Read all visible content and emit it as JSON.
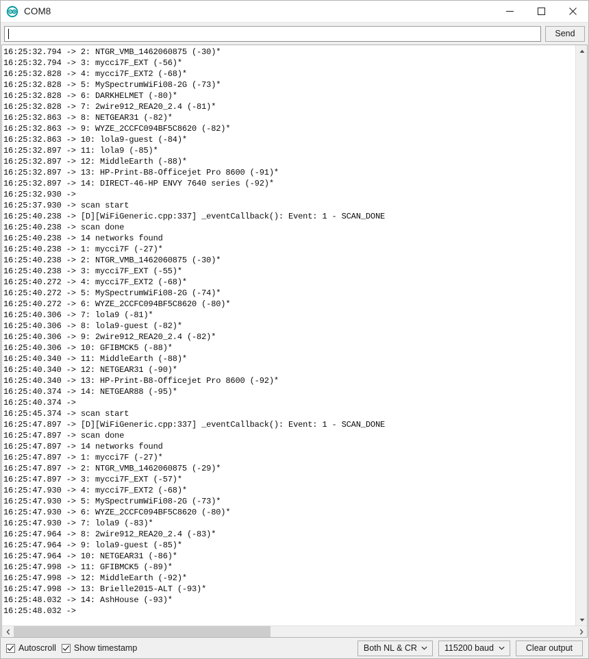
{
  "window": {
    "title": "COM8",
    "app_icon": "arduino-infinity-icon",
    "icon_color": "#00979c",
    "controls": {
      "minimize": "minimize-icon",
      "maximize": "maximize-icon",
      "close": "close-icon"
    }
  },
  "send_row": {
    "input_value": "",
    "input_placeholder": "",
    "send_label": "Send"
  },
  "console": {
    "lines": [
      "16:25:32.794 -> 2: NTGR_VMB_1462060875 (-30)*",
      "16:25:32.794 -> 3: mycci7F_EXT (-56)*",
      "16:25:32.828 -> 4: mycci7F_EXT2 (-68)*",
      "16:25:32.828 -> 5: MySpectrumWiFi08-2G (-73)*",
      "16:25:32.828 -> 6: DARKHELMET (-80)*",
      "16:25:32.828 -> 7: 2wire912_REA20_2.4 (-81)*",
      "16:25:32.863 -> 8: NETGEAR31 (-82)*",
      "16:25:32.863 -> 9: WYZE_2CCFC094BF5C8620 (-82)*",
      "16:25:32.863 -> 10: lola9-guest (-84)*",
      "16:25:32.897 -> 11: lola9 (-85)*",
      "16:25:32.897 -> 12: MiddleEarth (-88)*",
      "16:25:32.897 -> 13: HP-Print-B8-Officejet Pro 8600 (-91)*",
      "16:25:32.897 -> 14: DIRECT-46-HP ENVY 7640 series (-92)*",
      "16:25:32.930 -> ",
      "16:25:37.930 -> scan start",
      "16:25:40.238 -> [D][WiFiGeneric.cpp:337] _eventCallback(): Event: 1 - SCAN_DONE",
      "16:25:40.238 -> scan done",
      "16:25:40.238 -> 14 networks found",
      "16:25:40.238 -> 1: mycci7F (-27)*",
      "16:25:40.238 -> 2: NTGR_VMB_1462060875 (-30)*",
      "16:25:40.238 -> 3: mycci7F_EXT (-55)*",
      "16:25:40.272 -> 4: mycci7F_EXT2 (-68)*",
      "16:25:40.272 -> 5: MySpectrumWiFi08-2G (-74)*",
      "16:25:40.272 -> 6: WYZE_2CCFC094BF5C8620 (-80)*",
      "16:25:40.306 -> 7: lola9 (-81)*",
      "16:25:40.306 -> 8: lola9-guest (-82)*",
      "16:25:40.306 -> 9: 2wire912_REA20_2.4 (-82)*",
      "16:25:40.306 -> 10: GFIBMCK5 (-88)*",
      "16:25:40.340 -> 11: MiddleEarth (-88)*",
      "16:25:40.340 -> 12: NETGEAR31 (-90)*",
      "16:25:40.340 -> 13: HP-Print-B8-Officejet Pro 8600 (-92)*",
      "16:25:40.374 -> 14: NETGEAR88 (-95)*",
      "16:25:40.374 -> ",
      "16:25:45.374 -> scan start",
      "16:25:47.897 -> [D][WiFiGeneric.cpp:337] _eventCallback(): Event: 1 - SCAN_DONE",
      "16:25:47.897 -> scan done",
      "16:25:47.897 -> 14 networks found",
      "16:25:47.897 -> 1: mycci7F (-27)*",
      "16:25:47.897 -> 2: NTGR_VMB_1462060875 (-29)*",
      "16:25:47.897 -> 3: mycci7F_EXT (-57)*",
      "16:25:47.930 -> 4: mycci7F_EXT2 (-68)*",
      "16:25:47.930 -> 5: MySpectrumWiFi08-2G (-73)*",
      "16:25:47.930 -> 6: WYZE_2CCFC094BF5C8620 (-80)*",
      "16:25:47.930 -> 7: lola9 (-83)*",
      "16:25:47.964 -> 8: 2wire912_REA20_2.4 (-83)*",
      "16:25:47.964 -> 9: lola9-guest (-85)*",
      "16:25:47.964 -> 10: NETGEAR31 (-86)*",
      "16:25:47.998 -> 11: GFIBMCK5 (-89)*",
      "16:25:47.998 -> 12: MiddleEarth (-92)*",
      "16:25:47.998 -> 13: Brielle2015-ALT (-93)*",
      "16:25:48.032 -> 14: AshHouse (-93)*",
      "16:25:48.032 -> "
    ]
  },
  "scrollbars": {
    "vertical": {
      "up_arrow": "chevron-up-icon",
      "down_arrow": "chevron-down-icon"
    },
    "horizontal": {
      "left_arrow": "chevron-left-icon",
      "right_arrow": "chevron-right-icon"
    }
  },
  "statusbar": {
    "autoscroll_label": "Autoscroll",
    "autoscroll_checked": true,
    "show_timestamp_label": "Show timestamp",
    "show_timestamp_checked": true,
    "line_ending": "Both NL & CR",
    "baud_rate": "115200 baud",
    "clear_label": "Clear output"
  }
}
